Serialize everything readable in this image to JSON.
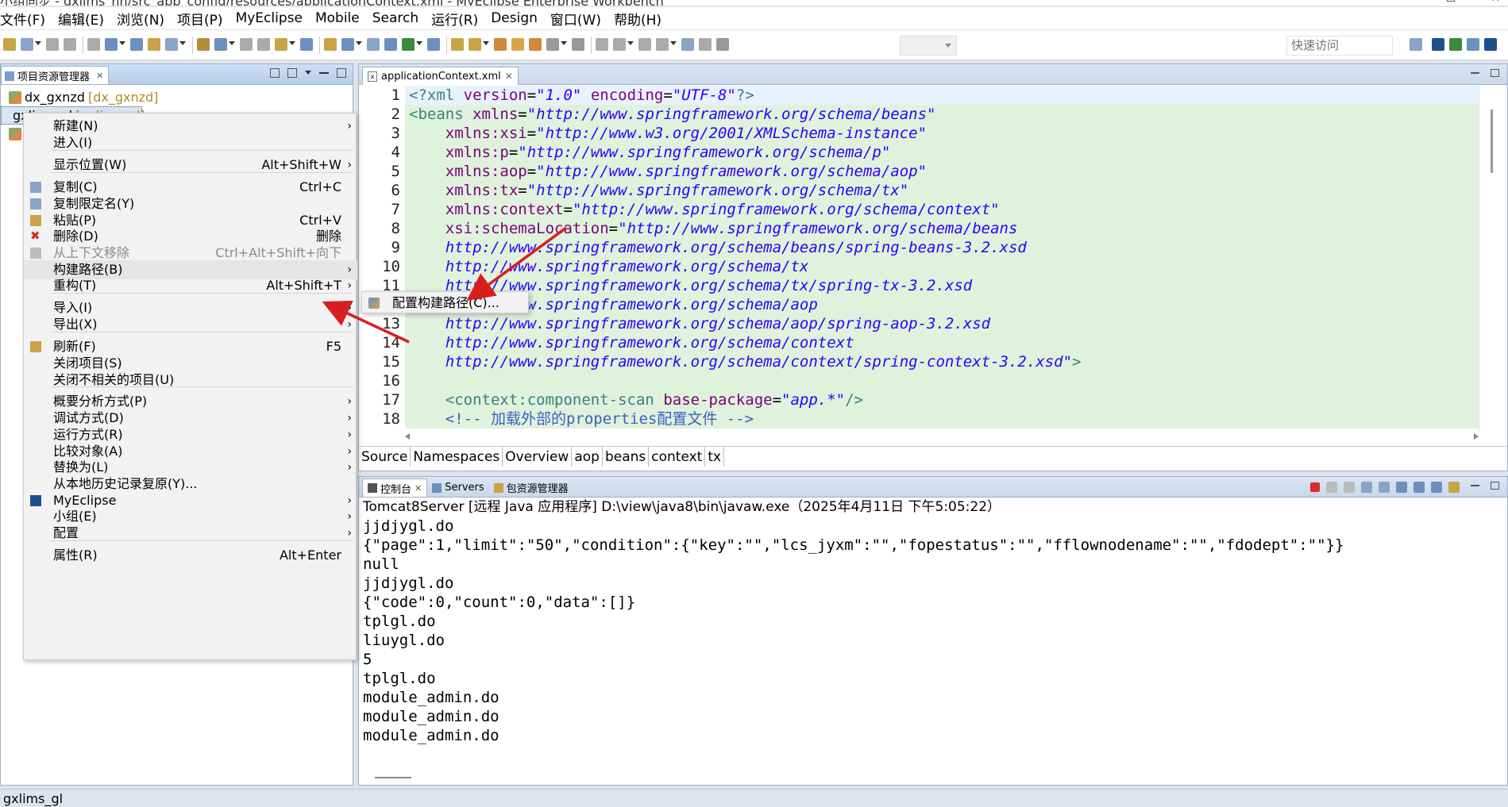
{
  "window": {
    "title": "小组同步 - gxlims_nn/src_app_config/resources/applicationContext.xml - MyEclipse Enterprise Workbench"
  },
  "menubar": [
    "文件(F)",
    "编辑(E)",
    "浏览(N)",
    "项目(P)",
    "MyEclipse",
    "Mobile",
    "Search",
    "运行(R)",
    "Design",
    "窗口(W)",
    "帮助(H)"
  ],
  "quick_access": {
    "placeholder": "快速访问"
  },
  "project_explorer": {
    "tab_label": "项目资源管理器",
    "items": [
      {
        "name": "dx_gxnzd",
        "decoration": "[dx_gxnzd]"
      },
      {
        "name": "gxlims_gl",
        "decoration": "[gxlims_gl]"
      }
    ]
  },
  "context_menu": {
    "items": [
      {
        "label": "新建(N)",
        "accel": "",
        "submenu": true
      },
      {
        "label": "进入(I)",
        "accel": ""
      },
      {
        "label": "显示位置(W)",
        "accel": "Alt+Shift+W",
        "submenu": true
      },
      {
        "label": "复制(C)",
        "accel": "Ctrl+C",
        "icon": "copy-icon"
      },
      {
        "label": "复制限定名(Y)",
        "accel": "",
        "icon": "copy-qualified-icon"
      },
      {
        "label": "粘贴(P)",
        "accel": "Ctrl+V",
        "icon": "paste-icon"
      },
      {
        "label": "删除(D)",
        "accel": "删除",
        "icon": "delete-icon"
      },
      {
        "label": "从上下文移除",
        "accel": "Ctrl+Alt+Shift+向下",
        "disabled": true,
        "icon": "remove-context-icon"
      },
      {
        "label": "构建路径(B)",
        "accel": "",
        "submenu": true
      },
      {
        "label": "重构(T)",
        "accel": "Alt+Shift+T",
        "submenu": true
      },
      {
        "label": "导入(I)",
        "accel": "",
        "submenu": true
      },
      {
        "label": "导出(X)",
        "accel": "",
        "submenu": true
      },
      {
        "label": "刷新(F)",
        "accel": "F5",
        "icon": "refresh-icon"
      },
      {
        "label": "关闭项目(S)",
        "accel": ""
      },
      {
        "label": "关闭不相关的项目(U)",
        "accel": ""
      },
      {
        "label": "概要分析方式(P)",
        "accel": "",
        "submenu": true
      },
      {
        "label": "调试方式(D)",
        "accel": "",
        "submenu": true
      },
      {
        "label": "运行方式(R)",
        "accel": "",
        "submenu": true
      },
      {
        "label": "比较对象(A)",
        "accel": "",
        "submenu": true
      },
      {
        "label": "替换为(L)",
        "accel": "",
        "submenu": true
      },
      {
        "label": "从本地历史记录复原(Y)...",
        "accel": ""
      },
      {
        "label": "MyEclipse",
        "accel": "",
        "submenu": true,
        "icon": "myeclipse-icon"
      },
      {
        "label": "小组(E)",
        "accel": "",
        "submenu": true
      },
      {
        "label": "配置",
        "accel": "",
        "submenu": true
      },
      {
        "label": "属性(R)",
        "accel": "Alt+Enter"
      }
    ]
  },
  "submenu": {
    "label": "配置构建路径(C)..."
  },
  "editor": {
    "tab_label": "applicationContext.xml",
    "bottom_tabs": [
      "Source",
      "Namespaces",
      "Overview",
      "aop",
      "beans",
      "context",
      "tx"
    ],
    "lines": [
      {
        "n": "1",
        "parts": [
          [
            "tag",
            "<?xml "
          ],
          [
            "att",
            "version"
          ],
          [
            "br",
            "="
          ],
          [
            "val",
            "\"1.0\""
          ],
          [
            "br",
            " "
          ],
          [
            "att",
            "encoding"
          ],
          [
            "br",
            "="
          ],
          [
            "val",
            "\"UTF-8\""
          ],
          [
            "tag",
            "?>"
          ]
        ]
      },
      {
        "n": "2",
        "parts": [
          [
            "tag",
            "<beans "
          ],
          [
            "att",
            "xmlns"
          ],
          [
            "br",
            "="
          ],
          [
            "val",
            "\"http://www.springframework.org/schema/beans\""
          ]
        ]
      },
      {
        "n": "3",
        "parts": [
          [
            "br",
            "    "
          ],
          [
            "att",
            "xmlns:xsi"
          ],
          [
            "br",
            "="
          ],
          [
            "val",
            "\"http://www.w3.org/2001/XMLSchema-instance\""
          ]
        ]
      },
      {
        "n": "4",
        "parts": [
          [
            "br",
            "    "
          ],
          [
            "att",
            "xmlns:p"
          ],
          [
            "br",
            "="
          ],
          [
            "val",
            "\"http://www.springframework.org/schema/p\""
          ]
        ]
      },
      {
        "n": "5",
        "parts": [
          [
            "br",
            "    "
          ],
          [
            "att",
            "xmlns:aop"
          ],
          [
            "br",
            "="
          ],
          [
            "val",
            "\"http://www.springframework.org/schema/aop\""
          ]
        ]
      },
      {
        "n": "6",
        "parts": [
          [
            "br",
            "    "
          ],
          [
            "att",
            "xmlns:tx"
          ],
          [
            "br",
            "="
          ],
          [
            "val",
            "\"http://www.springframework.org/schema/tx\""
          ]
        ]
      },
      {
        "n": "7",
        "parts": [
          [
            "br",
            "    "
          ],
          [
            "att",
            "xmlns:context"
          ],
          [
            "br",
            "="
          ],
          [
            "val",
            "\"http://www.springframework.org/schema/context\""
          ]
        ]
      },
      {
        "n": "8",
        "parts": [
          [
            "br",
            "    "
          ],
          [
            "att",
            "xsi:schemaLocation"
          ],
          [
            "br",
            "="
          ],
          [
            "val",
            "\"http://www.springframework.org/schema/beans"
          ]
        ]
      },
      {
        "n": "9",
        "parts": [
          [
            "br",
            "    "
          ],
          [
            "val",
            "http://www.springframework.org/schema/beans/spring-beans-3.2.xsd"
          ]
        ]
      },
      {
        "n": "10",
        "parts": [
          [
            "br",
            "    "
          ],
          [
            "val",
            "http://www.springframework.org/schema/tx"
          ]
        ]
      },
      {
        "n": "11",
        "parts": [
          [
            "br",
            "    "
          ],
          [
            "val",
            "http://www.springframework.org/schema/tx/spring-tx-3.2.xsd"
          ]
        ]
      },
      {
        "n": "12",
        "parts": [
          [
            "br",
            "    "
          ],
          [
            "val",
            "http://www.springframework.org/schema/aop"
          ]
        ]
      },
      {
        "n": "13",
        "parts": [
          [
            "br",
            "    "
          ],
          [
            "val",
            "http://www.springframework.org/schema/aop/spring-aop-3.2.xsd"
          ]
        ]
      },
      {
        "n": "14",
        "parts": [
          [
            "br",
            "    "
          ],
          [
            "val",
            "http://www.springframework.org/schema/context"
          ]
        ]
      },
      {
        "n": "15",
        "parts": [
          [
            "br",
            "    "
          ],
          [
            "val",
            "http://www.springframework.org/schema/context/spring-context-3.2.xsd\""
          ],
          [
            "tag",
            ">"
          ]
        ]
      },
      {
        "n": "16",
        "parts": []
      },
      {
        "n": "17",
        "parts": [
          [
            "br",
            "    "
          ],
          [
            "tag",
            "<context:component-scan "
          ],
          [
            "att",
            "base-package"
          ],
          [
            "br",
            "="
          ],
          [
            "val",
            "\"app.*\""
          ],
          [
            "tag",
            "/>"
          ]
        ]
      },
      {
        "n": "18",
        "parts": [
          [
            "br",
            "    "
          ],
          [
            "cmt",
            "<!-- 加载外部的properties配置文件 -->"
          ]
        ]
      }
    ]
  },
  "console": {
    "tabs": [
      "控制台",
      "Servers",
      "包资源管理器"
    ],
    "description": "Tomcat8Server [远程 Java 应用程序] D:\\view\\java8\\bin\\javaw.exe（2025年4月11日 下午5:05:22）",
    "lines": [
      "jjdjygl.do",
      "{\"page\":1,\"limit\":\"50\",\"condition\":{\"key\":\"\",\"lcs_jyxm\":\"\",\"fopestatus\":\"\",\"fflownodename\":\"\",\"fdodept\":\"\"}}",
      "null",
      "jjdjygl.do",
      "{\"code\":0,\"count\":0,\"data\":[]}",
      "tplgl.do",
      "liuygl.do",
      "5",
      "tplgl.do",
      "module_admin.do",
      "module_admin.do",
      "module_admin.do"
    ]
  },
  "statusbar": {
    "text": "gxlims_gl"
  },
  "colors": {
    "accent": "#d81e1e",
    "code_bg": "#dff2dc"
  }
}
